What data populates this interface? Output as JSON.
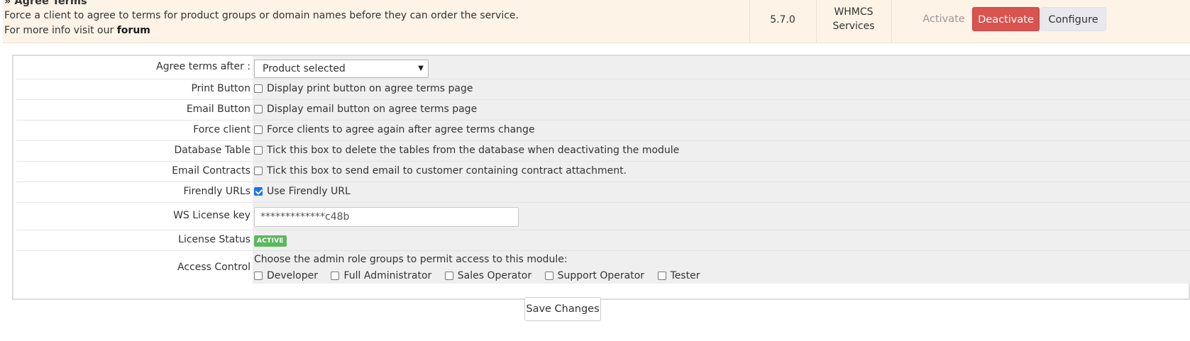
{
  "module": {
    "title": "» Agree Terms",
    "description": "Force a client to agree to terms for product groups or domain names before they can order the service.",
    "more_info_prefix": "For more info visit our ",
    "forum_link": "forum",
    "version": "5.7.0",
    "author_line1": "WHMCS",
    "author_line2": "Services",
    "activate_label": "Activate",
    "deactivate_label": "Deactivate",
    "configure_label": "Configure"
  },
  "config": {
    "agree_after": {
      "label": "Agree terms after :",
      "value": "Product selected"
    },
    "print_button": {
      "label": "Print Button",
      "text": "Display print button on agree terms page",
      "checked": false
    },
    "email_button": {
      "label": "Email Button",
      "text": "Display email button on agree terms page",
      "checked": false
    },
    "force_client": {
      "label": "Force client",
      "text": "Force clients to agree again after agree terms change",
      "checked": false
    },
    "database_table": {
      "label": "Database Table",
      "text": "Tick this box to delete the tables from the database when deactivating the module",
      "checked": false
    },
    "email_contracts": {
      "label": "Email Contracts",
      "text": "Tick this box to send email to customer containing contract attachment.",
      "checked": false
    },
    "friendly_urls": {
      "label": "Firendly URLs",
      "text": "Use Firendly URL",
      "checked": true
    },
    "license_key": {
      "label": "WS License key",
      "value": "*************c48b"
    },
    "license_status": {
      "label": "License Status",
      "badge": "ACTIVE",
      "badge_color": "#5cb85c"
    },
    "access_control": {
      "label": "Access Control",
      "intro": "Choose the admin role groups to permit access to this module:",
      "roles": [
        {
          "name": "Developer",
          "checked": false
        },
        {
          "name": "Full Administrator",
          "checked": false
        },
        {
          "name": "Sales Operator",
          "checked": false
        },
        {
          "name": "Support Operator",
          "checked": false
        },
        {
          "name": "Tester",
          "checked": false
        }
      ]
    }
  },
  "save_label": "Save Changes",
  "colors": {
    "module_row_bg": "#fdf3e6",
    "deactivate_bg": "#d9534f",
    "field_bg": "#efefef"
  }
}
